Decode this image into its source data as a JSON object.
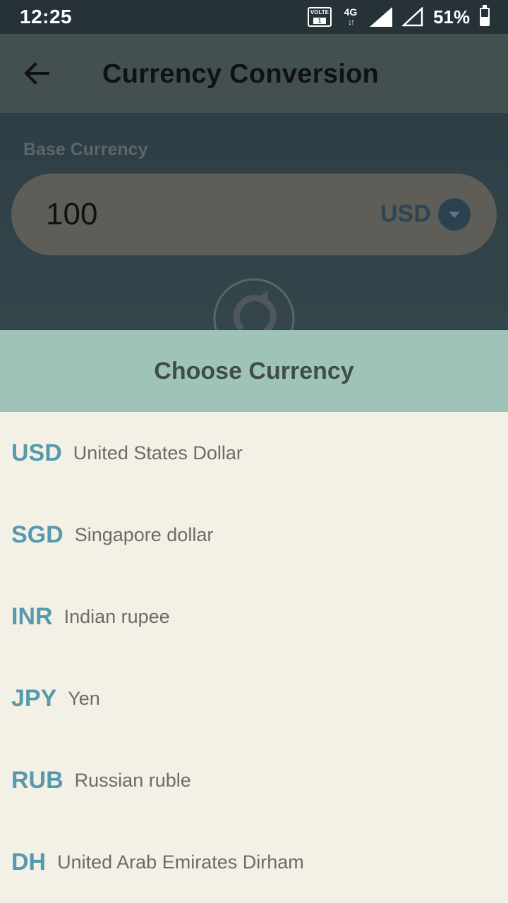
{
  "status_bar": {
    "time": "12:25",
    "volte_label": "VOLTE",
    "volte_sim": "1",
    "network_label": "4G",
    "network_arrows": "↓↑",
    "battery_percent": "51%",
    "battery_level": 0.51
  },
  "app_bar": {
    "title": "Currency Conversion",
    "back_icon": "arrow-back-icon"
  },
  "base": {
    "label": "Base Currency",
    "amount": "100",
    "currency_code": "USD",
    "dropdown_icon": "chevron-down-icon",
    "swap_icon": "refresh-icon"
  },
  "picker": {
    "title": "Choose Currency",
    "items": [
      {
        "code": "USD",
        "name": "United States Dollar"
      },
      {
        "code": "SGD",
        "name": "Singapore dollar"
      },
      {
        "code": "INR",
        "name": "Indian rupee"
      },
      {
        "code": "JPY",
        "name": "Yen"
      },
      {
        "code": "RUB",
        "name": "Russian ruble"
      },
      {
        "code": "DH",
        "name": "United Arab Emirates Dirham"
      }
    ]
  },
  "colors": {
    "status_bar": "#263238",
    "app_bar": "#444f50",
    "sheet_header": "#a0c3b9",
    "sheet_bg": "#f3f1e6",
    "code_accent": "#5799ae"
  }
}
